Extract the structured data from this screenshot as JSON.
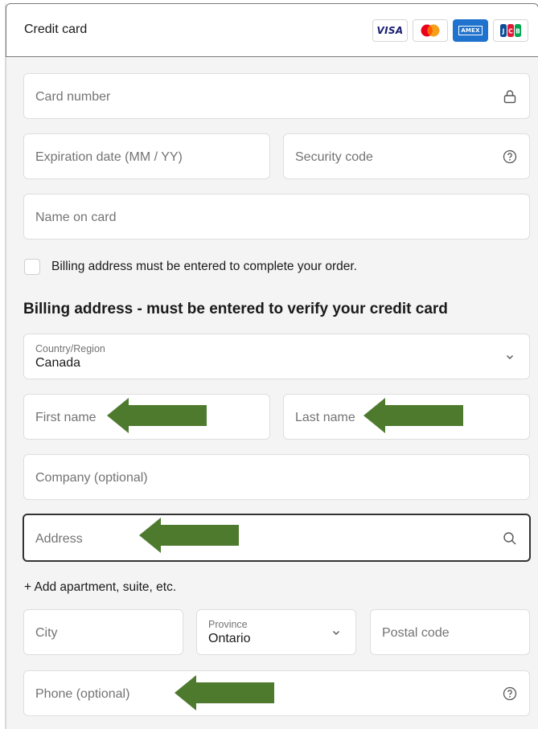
{
  "header": {
    "title": "Credit card",
    "card_brands": [
      {
        "name": "visa",
        "label": "VISA"
      },
      {
        "name": "mastercard",
        "label": ""
      },
      {
        "name": "amex",
        "label": "AMEX"
      },
      {
        "name": "jcb",
        "label": "JCB"
      }
    ]
  },
  "card_fields": {
    "card_number": "Card number",
    "expiration": "Expiration date (MM / YY)",
    "security_code": "Security code",
    "name_on_card": "Name on card"
  },
  "billing_checkbox": {
    "label": "Billing address must be entered to complete your order.",
    "checked": false
  },
  "billing": {
    "heading": "Billing address - must be entered to verify your credit card",
    "country_label": "Country/Region",
    "country_value": "Canada",
    "first_name": "First name",
    "last_name": "Last name",
    "company": "Company (optional)",
    "address": "Address",
    "add_apartment": "+ Add apartment, suite, etc.",
    "city": "City",
    "province_label": "Province",
    "province_value": "Ontario",
    "postal_code": "Postal code",
    "phone": "Phone (optional)"
  },
  "annotation_color": "#4e7a2e"
}
